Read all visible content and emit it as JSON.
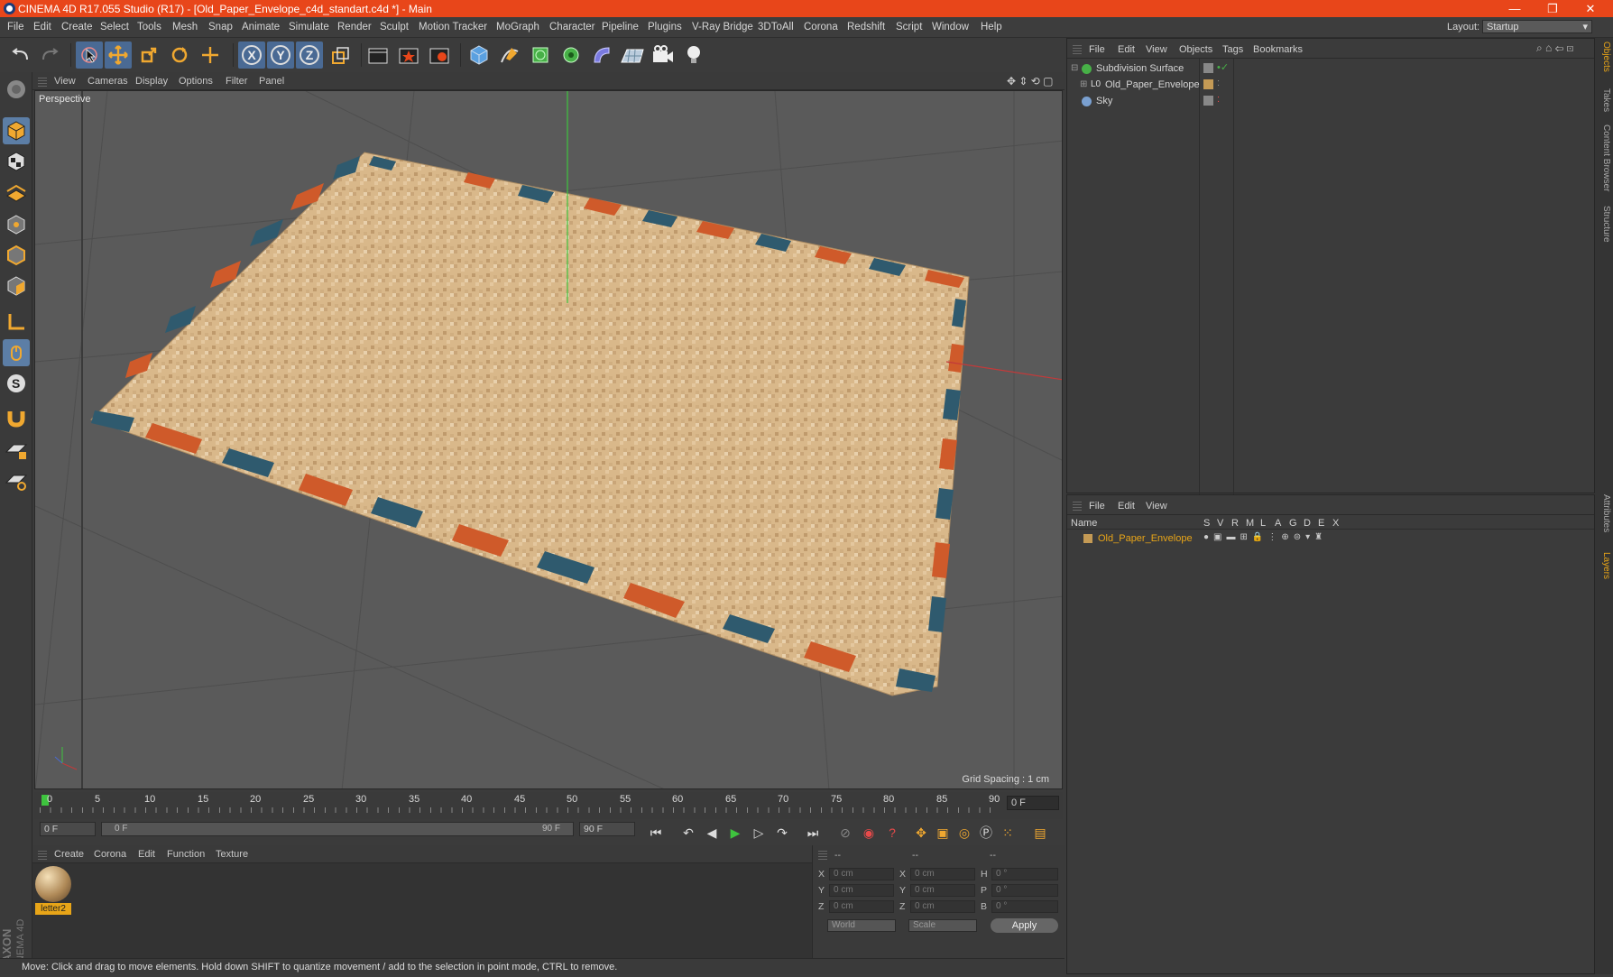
{
  "window": {
    "title": "CINEMA 4D R17.055 Studio (R17) - [Old_Paper_Envelope_c4d_standart.c4d *] - Main",
    "minimize": "—",
    "restore": "❐",
    "close": "✕"
  },
  "menu": [
    "File",
    "Edit",
    "Create",
    "Select",
    "Tools",
    "Mesh",
    "Snap",
    "Animate",
    "Simulate",
    "Render",
    "Sculpt",
    "Motion Tracker",
    "MoGraph",
    "Character",
    "Pipeline",
    "Plugins",
    "V-Ray Bridge",
    "3DToAll",
    "Corona",
    "Redshift",
    "Script",
    "Window",
    "Help"
  ],
  "layout": {
    "label": "Layout:",
    "value": "Startup"
  },
  "toolbar": {
    "x": "X",
    "y": "Y",
    "z": "Z"
  },
  "viewport": {
    "menu": [
      "View",
      "Cameras",
      "Display",
      "Options",
      "Filter",
      "Panel"
    ],
    "label": "Perspective",
    "grid_spacing": "Grid Spacing : 1 cm"
  },
  "timeline": {
    "ticks": [
      "0",
      "5",
      "10",
      "15",
      "20",
      "25",
      "30",
      "35",
      "40",
      "45",
      "50",
      "55",
      "60",
      "65",
      "70",
      "75",
      "80",
      "85",
      "90"
    ],
    "current": "0 F",
    "start": "0 F",
    "range_start": "0 F",
    "range_end": "90 F",
    "end": "90 F"
  },
  "materials": {
    "menu": [
      "Create",
      "Corona",
      "Edit",
      "Function",
      "Texture"
    ],
    "items": [
      {
        "name": "letter2"
      }
    ]
  },
  "coords": {
    "headers": [
      "--",
      "--",
      "--"
    ],
    "rows": [
      {
        "a": "X",
        "av": "0 cm",
        "b": "X",
        "bv": "0 cm",
        "c": "H",
        "cv": "0 °"
      },
      {
        "a": "Y",
        "av": "0 cm",
        "b": "Y",
        "bv": "0 cm",
        "c": "P",
        "cv": "0 °"
      },
      {
        "a": "Z",
        "av": "0 cm",
        "b": "Z",
        "bv": "0 cm",
        "c": "B",
        "cv": "0 °"
      }
    ],
    "world": "World",
    "scale": "Scale",
    "apply": "Apply"
  },
  "objects": {
    "menu": [
      "File",
      "Edit",
      "View",
      "Objects",
      "Tags",
      "Bookmarks"
    ],
    "items": [
      {
        "name": "Subdivision Surface"
      },
      {
        "name": "Old_Paper_Envelope"
      },
      {
        "name": "Sky"
      }
    ]
  },
  "layers": {
    "menu": [
      "File",
      "Edit",
      "View"
    ],
    "headers": {
      "name": "Name",
      "cols": [
        "S",
        "V",
        "R",
        "M",
        "L",
        "A",
        "G",
        "D",
        "E",
        "X"
      ]
    },
    "items": [
      {
        "name": "Old_Paper_Envelope"
      }
    ]
  },
  "sidetabs": [
    "Objects",
    "Takes",
    "Content Browser",
    "Structure",
    "Attributes",
    "Layers"
  ],
  "status": "Move: Click and drag to move elements. Hold down SHIFT to quantize movement / add to the selection in point mode, CTRL to remove.",
  "colors": {
    "title_bar": "#e8461a",
    "accent": "#e8a518",
    "selected_tool": "#5c7ea6"
  }
}
